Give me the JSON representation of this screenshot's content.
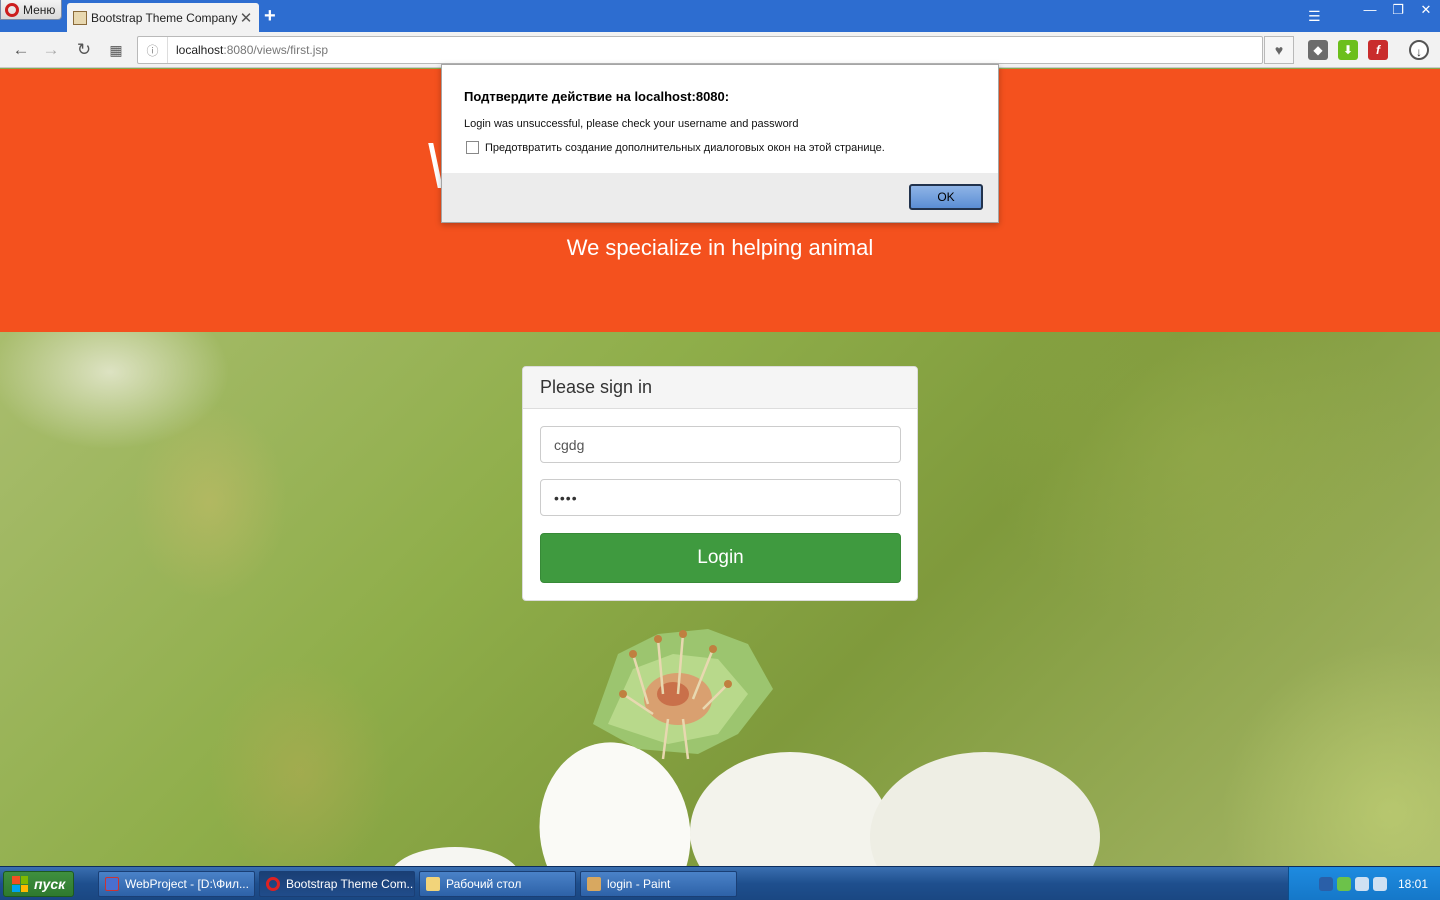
{
  "browser": {
    "menu_label": "Меню",
    "tab_title": "Bootstrap Theme Company",
    "url_host": "localhost",
    "url_rest": ":8080/views/first.jsp"
  },
  "page": {
    "hero_subtitle": "We specialize in helping animal"
  },
  "login": {
    "heading": "Please sign in",
    "username_value": "cgdg",
    "password_value": "••••",
    "login_label": "Login"
  },
  "dialog": {
    "title": "Подтвердите действие на localhost:8080:",
    "message": "Login was unsuccessful, please check your username and password",
    "checkbox_label": "Предотвратить создание дополнительных диалоговых окон на этой странице.",
    "ok_label": "OK"
  },
  "taskbar": {
    "start_label": "пуск",
    "tasks": [
      {
        "label": "WebProject - [D:\\Фил..."
      },
      {
        "label": "Bootstrap Theme Com..."
      },
      {
        "label": "Рабочий стол"
      },
      {
        "label": "login - Paint"
      }
    ],
    "clock": "18:01"
  },
  "colors": {
    "hero": "#f4511e",
    "login_button": "#3f9a3f",
    "taskbar": "#1e4f8e"
  }
}
